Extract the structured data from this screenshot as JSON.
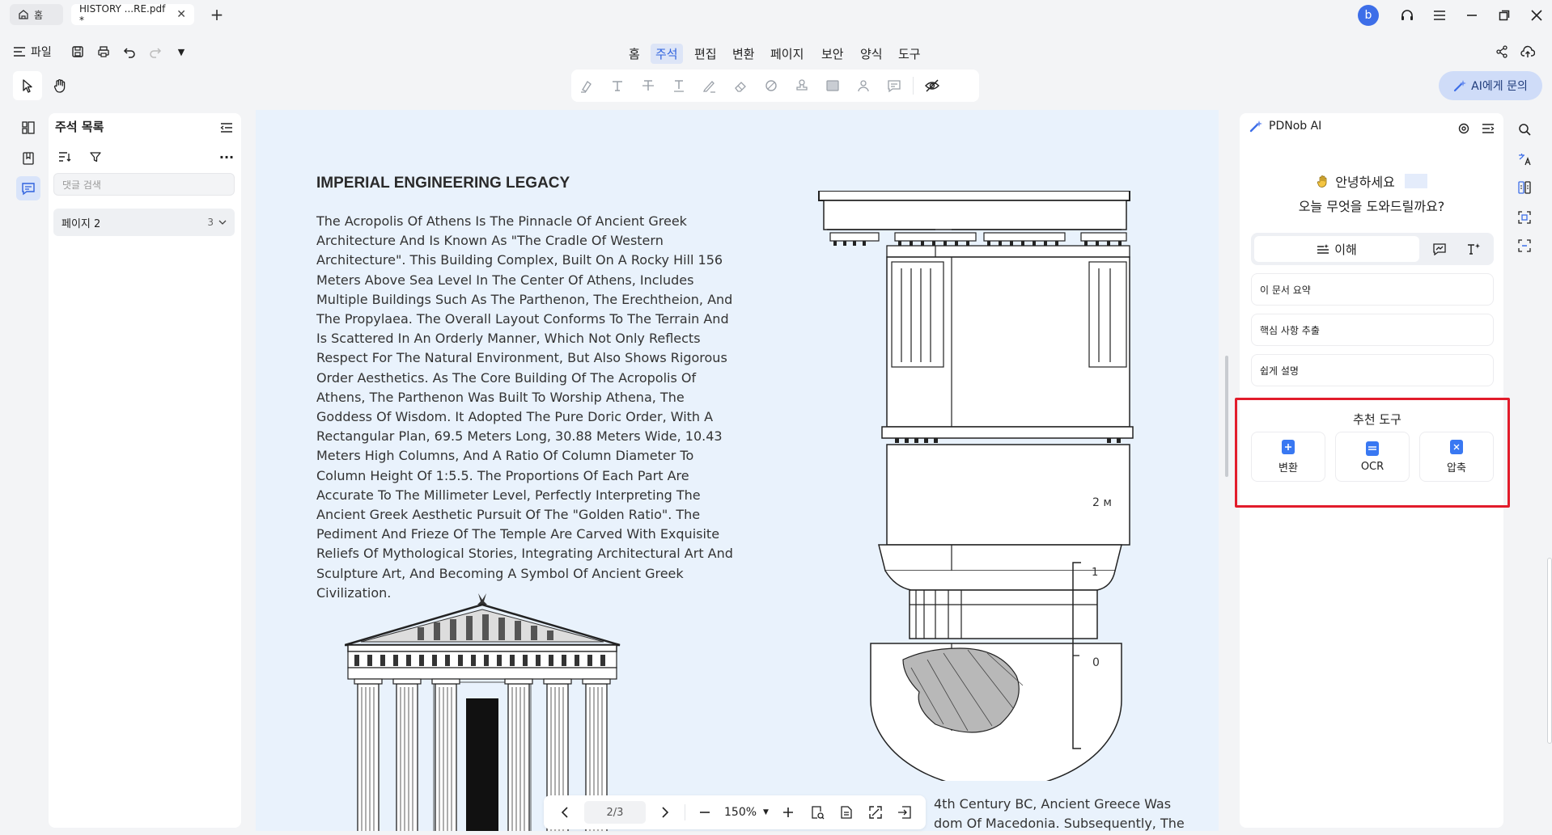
{
  "titlebar": {
    "home_tab": "홈",
    "doc_tab": "HISTORY ...RE.pdf *",
    "avatar_letter": "b"
  },
  "menu": {
    "file": "파일",
    "items": [
      "홈",
      "주석",
      "편집",
      "변환",
      "페이지",
      "보안",
      "양식",
      "도구"
    ],
    "active": "주석"
  },
  "ai_button": "AI에게 문의",
  "annotation_panel": {
    "title": "주석 목록",
    "search_placeholder": "댓글 검색",
    "group_label": "페이지 2",
    "group_count": "3"
  },
  "document": {
    "title": "IMPERIAL ENGINEERING LEGACY",
    "body": "The Acropolis Of Athens Is The Pinnacle Of Ancient Greek Architecture And Is Known As \"The Cradle Of Western Architecture\". This Building Complex, Built On A Rocky Hill 156 Meters Above Sea Level In The Center Of Athens, Includes Multiple Buildings Such As The Parthenon, The Erechtheion, And The Propylaea. The Overall Layout Conforms To The Terrain And Is Scattered In An Orderly Manner, Which Not Only Reflects Respect For The Natural Environment, But Also Shows Rigorous Order Aesthetics. As The Core Building Of The Acropolis Of Athens, The Parthenon Was Built To Worship Athena, The Goddess Of Wisdom. It Adopted The Pure Doric Order, With A Rectangular Plan, 69.5 Meters Long, 30.88 Meters Wide, 10.43 Meters High Columns, And A Ratio Of Column Diameter To Column Height Of 1:5.5. The Proportions Of Each Part Are Accurate To The Millimeter Level, Perfectly Interpreting The Ancient Greek Aesthetic Pursuit Of The \"Golden Ratio\". The Pediment And Frieze Of The Temple Are Carved With Exquisite Reliefs Of Mythological Stories, Integrating Architectural Art And Sculpture Art, And Becoming A Symbol Of Ancient Greek Civilization.",
    "fragment_line1": "4th Century BC, Ancient Greece Was",
    "fragment_line2": "dom Of Macedonia. Subsequently, The",
    "scale_labels": [
      "2 м",
      "1",
      "0"
    ]
  },
  "bottom_nav": {
    "page": "2/3",
    "zoom": "150%"
  },
  "ai_panel": {
    "title": "PDNob AI",
    "greeting": "안녕하세요",
    "question": "오늘 무엇을 도와드릴까요?",
    "main_tab": "이해",
    "suggestions": [
      "이 문서 요약",
      "핵심 사항 추출",
      "쉽게 설명"
    ],
    "recommended_title": "추천 도구",
    "tools": [
      "변환",
      "OCR",
      "압축"
    ]
  },
  "colors": {
    "accent": "#2f62de",
    "highlight_box": "#e21c2b",
    "viewport_bg": "#e9f2fc"
  }
}
